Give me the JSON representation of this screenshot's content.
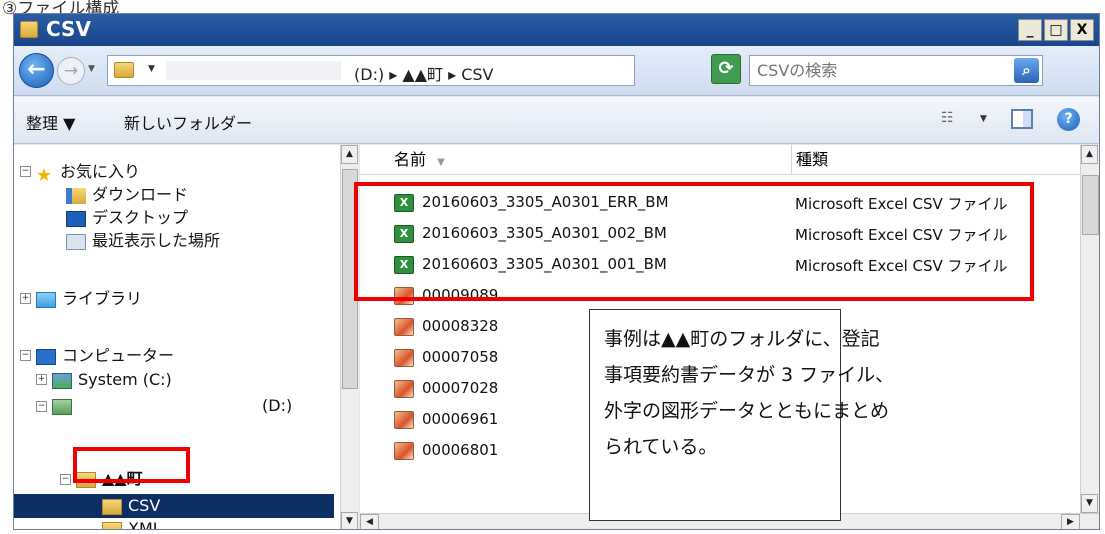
{
  "caption": "③ファイル構成",
  "window": {
    "title": "CSV",
    "controls": {
      "minimize": "_",
      "maximize": "□",
      "close": "X"
    }
  },
  "address": {
    "drive": "(D:)",
    "path_segments": [
      "▲▲町",
      "CSV"
    ],
    "path_text": "(D:) ▸ ▲▲町 ▸ CSV",
    "search_placeholder": "CSVの検索"
  },
  "toolbar": {
    "organize": "整理 ▼",
    "new_folder": "新しいフォルダー"
  },
  "nav": {
    "favorites": "お気に入り",
    "downloads": "ダウンロード",
    "desktop": "デスクトップ",
    "recent": "最近表示した場所",
    "libraries": "ライブラリ",
    "computer": "コンピューター",
    "system_drive": "System (C:)",
    "d_drive": "(D:)",
    "town_folder": "▲▲町",
    "csv_folder": "CSV",
    "xml_folder": "XML"
  },
  "columns": {
    "name": "名前",
    "type": "種類"
  },
  "files": [
    {
      "name": "20160603_3305_A0301_ERR_BM",
      "type": "Microsoft Excel CSV ファイル",
      "icon": "excel-csv-icon"
    },
    {
      "name": "20160603_3305_A0301_002_BM",
      "type": "Microsoft Excel CSV ファイル",
      "icon": "excel-csv-icon"
    },
    {
      "name": "20160603_3305_A0301_001_BM",
      "type": "Microsoft Excel CSV ファイル",
      "icon": "excel-csv-icon"
    },
    {
      "name": "00009089",
      "type": "",
      "icon": "image-file-icon"
    },
    {
      "name": "00008328",
      "type": "",
      "icon": "image-file-icon"
    },
    {
      "name": "00007058",
      "type": "",
      "icon": "image-file-icon"
    },
    {
      "name": "00007028",
      "type": "",
      "icon": "image-file-icon"
    },
    {
      "name": "00006961",
      "type": "",
      "icon": "image-file-icon"
    },
    {
      "name": "00006801",
      "type": "",
      "icon": "image-file-icon"
    }
  ],
  "callout": {
    "lines": [
      "事例は▲▲町のフォルダに、登記",
      "事項要約書データが 3 ファイル、",
      "外字の図形データとともにまとめ",
      "られている。"
    ]
  },
  "colors": {
    "titlebar": "#1f4f99",
    "highlight_box": "#ee0000",
    "selection": "#0b2e63"
  }
}
